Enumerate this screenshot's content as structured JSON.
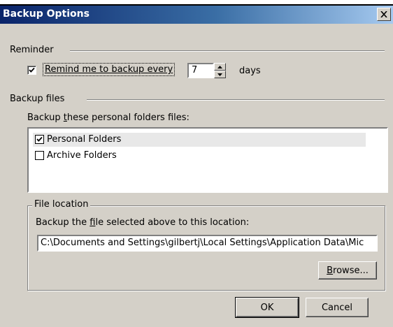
{
  "window": {
    "title": "Backup Options"
  },
  "reminder": {
    "section_label": "Reminder",
    "checkbox_label": "Remind me to backup every",
    "checked": true,
    "days_value": "7",
    "days_unit": "days"
  },
  "backup_files": {
    "section_label": "Backup files",
    "list_label_prefix": "Backup ",
    "list_label_mnemonic": "t",
    "list_label_suffix": "hese personal folders files:",
    "items": [
      {
        "label": "Personal Folders",
        "checked": true
      },
      {
        "label": "Archive Folders",
        "checked": false
      }
    ]
  },
  "file_location": {
    "group_label": "File location",
    "description_prefix": "Backup the ",
    "description_mnemonic": "f",
    "description_suffix": "ile selected above to this location:",
    "path": "C:\\Documents and Settings\\gilbertj\\Local Settings\\Application Data\\Mic",
    "browse_mnemonic": "B",
    "browse_suffix": "rowse..."
  },
  "buttons": {
    "ok": "OK",
    "cancel": "Cancel"
  }
}
